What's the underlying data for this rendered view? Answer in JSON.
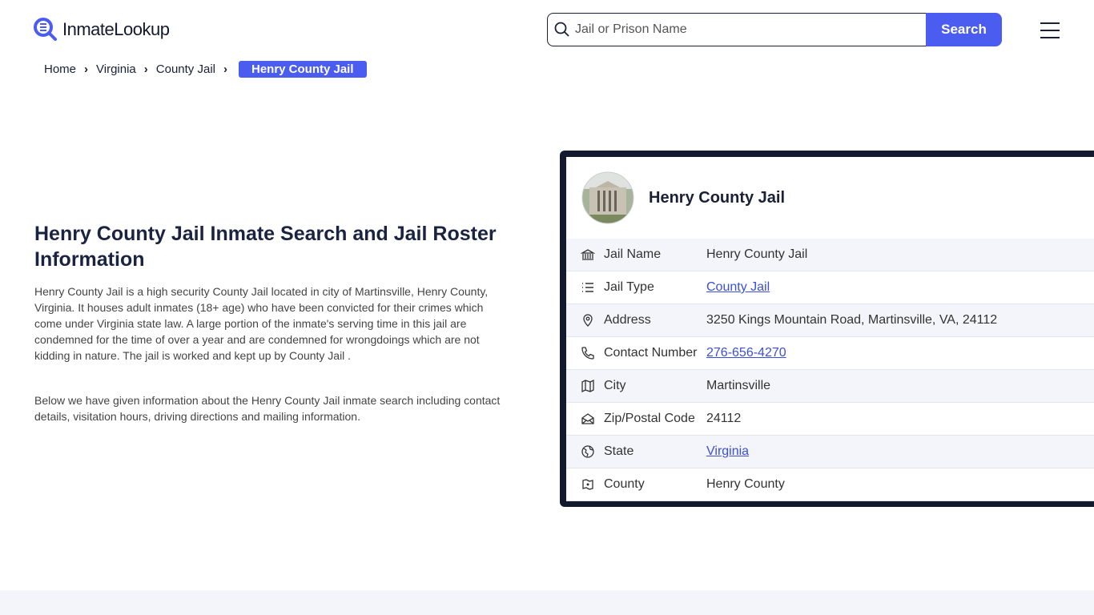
{
  "header": {
    "logo_text": "InmateLookup",
    "search_placeholder": "Jail or Prison Name",
    "search_label": "Search"
  },
  "breadcrumb": [
    "Home",
    "Virginia",
    "County Jail",
    "Henry County Jail"
  ],
  "main": {
    "title": "Henry County Jail Inmate Search and Jail Roster Information",
    "paragraph1": "Henry County Jail is a high security County Jail located in city of Martinsville, Henry County, Virginia. It houses adult inmates (18+ age) who have been convicted for their crimes which come under Virginia state law. A large portion of the inmate's serving time in this jail are condemned for the time of over a year and are condemned for wrongdoings which are not kidding in nature. The jail is worked and kept up by County Jail .",
    "paragraph2": "Below we have given information about the Henry County Jail inmate search including contact details, visitation hours, driving directions and mailing information."
  },
  "card": {
    "title": "Henry County Jail",
    "rows": [
      {
        "icon": "bank-icon",
        "label": "Jail Name",
        "value": "Henry County Jail"
      },
      {
        "icon": "list-icon",
        "label": "Jail Type",
        "value": "County Jail",
        "link": true
      },
      {
        "icon": "map-pin-icon",
        "label": "Address",
        "value": "3250 Kings Mountain Road, Martinsville, VA, 24112"
      },
      {
        "icon": "phone-icon",
        "label": "Contact Number",
        "value": "276-656-4270",
        "link": true
      },
      {
        "icon": "map-icon",
        "label": "City",
        "value": "Martinsville"
      },
      {
        "icon": "mail-open-icon",
        "label": "Zip/Postal Code",
        "value": "24112"
      },
      {
        "icon": "globe-icon",
        "label": "State",
        "value": "Virginia",
        "link": true
      },
      {
        "icon": "county-icon",
        "label": "County",
        "value": "Henry County"
      }
    ]
  },
  "colors": {
    "accent": "#4b5cf0",
    "dark": "#141a2e",
    "link": "#3b4fd8"
  }
}
